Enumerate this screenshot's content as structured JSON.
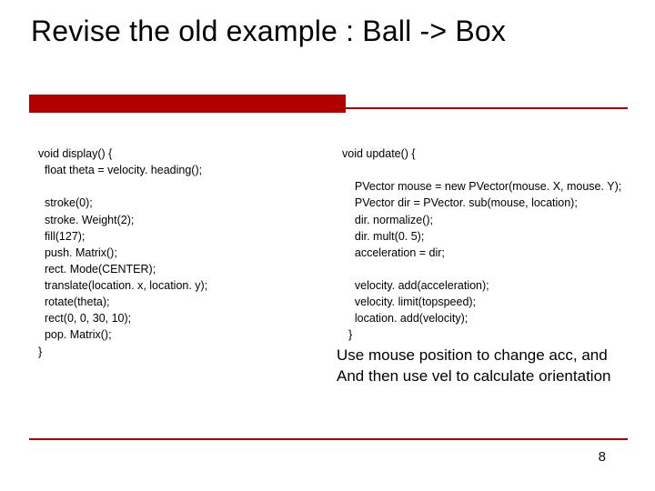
{
  "title": "Revise the old example : Ball -> Box",
  "code_left": "void display() {\n  float theta = velocity. heading();\n\n  stroke(0);\n  stroke. Weight(2);\n  fill(127);\n  push. Matrix();\n  rect. Mode(CENTER);\n  translate(location. x, location. y);\n  rotate(theta);\n  rect(0, 0, 30, 10);\n  pop. Matrix();\n}",
  "code_right": "void update() {\n\n    PVector mouse = new PVector(mouse. X, mouse. Y);\n    PVector dir = PVector. sub(mouse, location);\n    dir. normalize();\n    dir. mult(0. 5);\n    acceleration = dir;\n\n    velocity. add(acceleration);\n    velocity. limit(topspeed);\n    location. add(velocity);\n  }",
  "caption_line1": "Use mouse position to change acc, and",
  "caption_line2": "And then use vel to calculate orientation",
  "page_number": "8"
}
